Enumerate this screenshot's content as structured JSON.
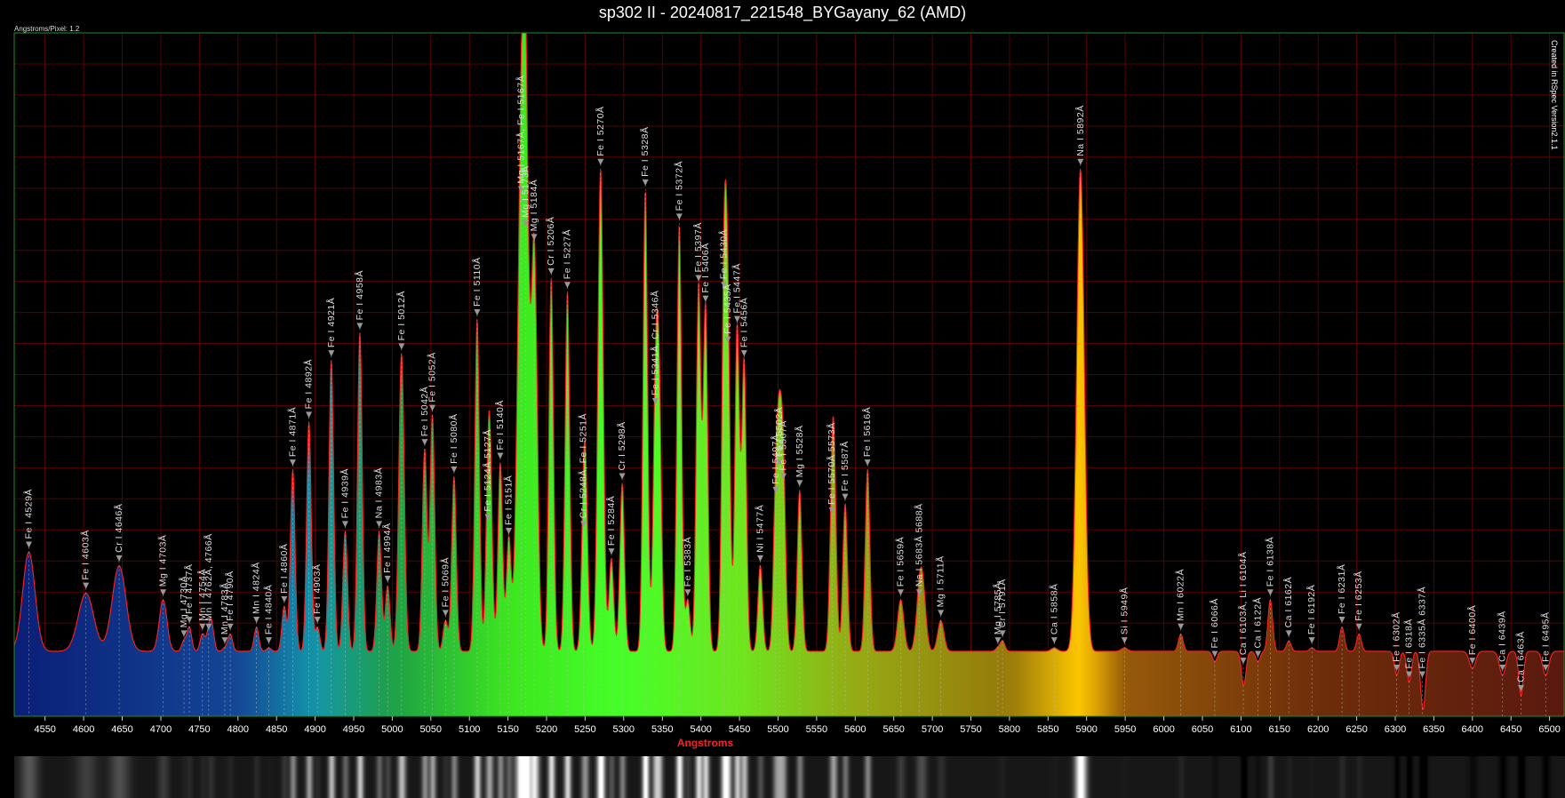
{
  "title": "sp302 II - 20240817_221548_BYGayany_62 (AMD)",
  "scale_label": "Angstroms/Pixel: 1.2",
  "credit": "Created in RSpec Version2.1.1",
  "colors": {
    "background": "#000000",
    "grid": "#5a0000",
    "profile": "#ff2020",
    "axis_title": "#ff2020",
    "frame": "#1f8f1f",
    "marker": "#999999"
  },
  "chart_data": {
    "type": "area",
    "title": "sp302 II - 20240817_221548_BYGayany_62 (AMD)",
    "xlabel": "Angstroms",
    "ylabel": "",
    "xlim": [
      4510,
      6520
    ],
    "ylim": [
      0,
      1.0
    ],
    "grid": true,
    "x_ticks": [
      4550,
      4600,
      4650,
      4700,
      4750,
      4800,
      4850,
      4900,
      4950,
      5000,
      5050,
      5100,
      5150,
      5200,
      5250,
      5300,
      5350,
      5400,
      5450,
      5500,
      5550,
      5600,
      5650,
      5700,
      5750,
      5800,
      5850,
      5900,
      5950,
      6000,
      6050,
      6100,
      6150,
      6200,
      6250,
      6300,
      6350,
      6400,
      6450,
      6500
    ],
    "baseline": 0.095,
    "peaks": [
      {
        "x": 4529,
        "y": 0.24,
        "w": 8
      },
      {
        "x": 4603,
        "y": 0.18,
        "w": 10
      },
      {
        "x": 4646,
        "y": 0.22,
        "w": 9
      },
      {
        "x": 4703,
        "y": 0.17,
        "w": 5
      },
      {
        "x": 4730,
        "y": 0.11,
        "w": 3
      },
      {
        "x": 4737,
        "y": 0.13,
        "w": 3
      },
      {
        "x": 4754,
        "y": 0.12,
        "w": 3
      },
      {
        "x": 4762,
        "y": 0.12,
        "w": 3
      },
      {
        "x": 4766,
        "y": 0.13,
        "w": 3
      },
      {
        "x": 4783,
        "y": 0.1,
        "w": 3
      },
      {
        "x": 4790,
        "y": 0.12,
        "w": 3
      },
      {
        "x": 4824,
        "y": 0.13,
        "w": 3
      },
      {
        "x": 4840,
        "y": 0.1,
        "w": 3
      },
      {
        "x": 4860,
        "y": 0.16,
        "w": 3
      },
      {
        "x": 4871,
        "y": 0.36,
        "w": 3
      },
      {
        "x": 4892,
        "y": 0.43,
        "w": 3
      },
      {
        "x": 4903,
        "y": 0.13,
        "w": 3
      },
      {
        "x": 4921,
        "y": 0.52,
        "w": 3
      },
      {
        "x": 4939,
        "y": 0.27,
        "w": 3
      },
      {
        "x": 4958,
        "y": 0.56,
        "w": 3
      },
      {
        "x": 4983,
        "y": 0.27,
        "w": 3
      },
      {
        "x": 4994,
        "y": 0.19,
        "w": 3
      },
      {
        "x": 5012,
        "y": 0.53,
        "w": 3.5
      },
      {
        "x": 5042,
        "y": 0.39,
        "w": 3
      },
      {
        "x": 5052,
        "y": 0.44,
        "w": 3
      },
      {
        "x": 5069,
        "y": 0.14,
        "w": 3
      },
      {
        "x": 5080,
        "y": 0.35,
        "w": 3
      },
      {
        "x": 5110,
        "y": 0.58,
        "w": 3
      },
      {
        "x": 5124,
        "y": 0.28,
        "w": 3
      },
      {
        "x": 5127,
        "y": 0.31,
        "w": 3
      },
      {
        "x": 5140,
        "y": 0.37,
        "w": 3
      },
      {
        "x": 5151,
        "y": 0.26,
        "w": 3
      },
      {
        "x": 5167,
        "y": 0.76,
        "w": 5
      },
      {
        "x": 5173,
        "y": 0.71,
        "w": 4
      },
      {
        "x": 5184,
        "y": 0.69,
        "w": 4
      },
      {
        "x": 5206,
        "y": 0.64,
        "w": 3
      },
      {
        "x": 5227,
        "y": 0.62,
        "w": 3
      },
      {
        "x": 5248,
        "y": 0.27,
        "w": 3
      },
      {
        "x": 5251,
        "y": 0.27,
        "w": 3
      },
      {
        "x": 5270,
        "y": 0.8,
        "w": 3.5
      },
      {
        "x": 5284,
        "y": 0.23,
        "w": 3
      },
      {
        "x": 5298,
        "y": 0.34,
        "w": 3
      },
      {
        "x": 5328,
        "y": 0.77,
        "w": 3
      },
      {
        "x": 5341,
        "y": 0.45,
        "w": 3
      },
      {
        "x": 5346,
        "y": 0.45,
        "w": 3
      },
      {
        "x": 5372,
        "y": 0.72,
        "w": 3
      },
      {
        "x": 5383,
        "y": 0.17,
        "w": 3
      },
      {
        "x": 5397,
        "y": 0.63,
        "w": 3
      },
      {
        "x": 5406,
        "y": 0.6,
        "w": 3
      },
      {
        "x": 5430,
        "y": 0.62,
        "w": 3
      },
      {
        "x": 5435,
        "y": 0.54,
        "w": 3
      },
      {
        "x": 5447,
        "y": 0.57,
        "w": 3
      },
      {
        "x": 5456,
        "y": 0.52,
        "w": 3
      },
      {
        "x": 5477,
        "y": 0.22,
        "w": 3
      },
      {
        "x": 5497,
        "y": 0.32,
        "w": 3
      },
      {
        "x": 5502,
        "y": 0.36,
        "w": 3
      },
      {
        "x": 5507,
        "y": 0.34,
        "w": 3
      },
      {
        "x": 5528,
        "y": 0.33,
        "w": 3
      },
      {
        "x": 5570,
        "y": 0.29,
        "w": 3
      },
      {
        "x": 5573,
        "y": 0.29,
        "w": 3
      },
      {
        "x": 5587,
        "y": 0.31,
        "w": 3
      },
      {
        "x": 5616,
        "y": 0.36,
        "w": 3
      },
      {
        "x": 5659,
        "y": 0.17,
        "w": 4
      },
      {
        "x": 5683,
        "y": 0.17,
        "w": 4
      },
      {
        "x": 5688,
        "y": 0.17,
        "w": 4
      },
      {
        "x": 5711,
        "y": 0.14,
        "w": 4
      },
      {
        "x": 5785,
        "y": 0.1,
        "w": 3
      },
      {
        "x": 5791,
        "y": 0.11,
        "w": 3
      },
      {
        "x": 5858,
        "y": 0.1,
        "w": 4
      },
      {
        "x": 5892,
        "y": 0.8,
        "w": 5
      },
      {
        "x": 5949,
        "y": 0.1,
        "w": 4
      },
      {
        "x": 6022,
        "y": 0.12,
        "w": 3
      },
      {
        "x": 6066,
        "y": 0.08,
        "w": 3
      },
      {
        "x": 6103,
        "y": 0.07,
        "w": 3
      },
      {
        "x": 6104,
        "y": 0.07,
        "w": 3
      },
      {
        "x": 6122,
        "y": 0.08,
        "w": 3
      },
      {
        "x": 6138,
        "y": 0.17,
        "w": 3
      },
      {
        "x": 6162,
        "y": 0.11,
        "w": 3
      },
      {
        "x": 6192,
        "y": 0.1,
        "w": 3
      },
      {
        "x": 6231,
        "y": 0.13,
        "w": 3
      },
      {
        "x": 6253,
        "y": 0.12,
        "w": 3
      },
      {
        "x": 6302,
        "y": 0.06,
        "w": 3
      },
      {
        "x": 6318,
        "y": 0.05,
        "w": 3
      },
      {
        "x": 6335,
        "y": 0.05,
        "w": 3
      },
      {
        "x": 6337,
        "y": 0.05,
        "w": 3
      },
      {
        "x": 6400,
        "y": 0.07,
        "w": 4
      },
      {
        "x": 6439,
        "y": 0.06,
        "w": 4
      },
      {
        "x": 6463,
        "y": 0.03,
        "w": 3
      },
      {
        "x": 6495,
        "y": 0.06,
        "w": 4
      }
    ],
    "annotations": [
      {
        "x": 4529,
        "y": 0.24,
        "text": "Fe I 4529Å"
      },
      {
        "x": 4603,
        "y": 0.18,
        "text": "Fe I 4603Å"
      },
      {
        "x": 4646,
        "y": 0.22,
        "text": "Cr I 4646Å"
      },
      {
        "x": 4703,
        "y": 0.17,
        "text": "Mg I 4703Å"
      },
      {
        "x": 4730,
        "y": 0.11,
        "text": "Mg I 4730Å"
      },
      {
        "x": 4737,
        "y": 0.13,
        "text": "Fe I 4737Å"
      },
      {
        "x": 4754,
        "y": 0.12,
        "text": "Mn I 4754Å"
      },
      {
        "x": 4762,
        "y": 0.12,
        "text": "Mn I 4762Å, 4766Å"
      },
      {
        "x": 4783,
        "y": 0.1,
        "text": "Mn I 4783Å"
      },
      {
        "x": 4790,
        "y": 0.12,
        "text": "Fe I 4790Å"
      },
      {
        "x": 4824,
        "y": 0.13,
        "text": "Mn I 4824Å"
      },
      {
        "x": 4840,
        "y": 0.1,
        "text": "Fe I 4840Å"
      },
      {
        "x": 4860,
        "y": 0.16,
        "text": "Fe I 4860Å"
      },
      {
        "x": 4871,
        "y": 0.36,
        "text": "Fe I 4871Å"
      },
      {
        "x": 4892,
        "y": 0.43,
        "text": "Fe I 4892Å"
      },
      {
        "x": 4903,
        "y": 0.13,
        "text": "Fe I 4903Å"
      },
      {
        "x": 4921,
        "y": 0.52,
        "text": "Fe I 4921Å"
      },
      {
        "x": 4939,
        "y": 0.27,
        "text": "Fe I 4939Å"
      },
      {
        "x": 4958,
        "y": 0.56,
        "text": "Fe I 4958Å"
      },
      {
        "x": 4983,
        "y": 0.27,
        "text": "Na I 4983Å"
      },
      {
        "x": 4994,
        "y": 0.19,
        "text": "Fe I 4994Å"
      },
      {
        "x": 5012,
        "y": 0.53,
        "text": "Fe I 5012Å"
      },
      {
        "x": 5042,
        "y": 0.39,
        "text": "Fe I 5042Å"
      },
      {
        "x": 5052,
        "y": 0.44,
        "text": "Fe I 5052Å"
      },
      {
        "x": 5069,
        "y": 0.14,
        "text": "Fe I 5069Å"
      },
      {
        "x": 5080,
        "y": 0.35,
        "text": "Fe I 5080Å"
      },
      {
        "x": 5110,
        "y": 0.58,
        "text": "Fe I 5110Å"
      },
      {
        "x": 5124,
        "y": 0.28,
        "text": "Fe I 5124Å 5127Å"
      },
      {
        "x": 5140,
        "y": 0.37,
        "text": "Fe I 5140Å"
      },
      {
        "x": 5151,
        "y": 0.26,
        "text": "Fe I 5151Å"
      },
      {
        "x": 5167,
        "y": 0.76,
        "text": "Mg I 5167Å, Fe I 5167Å"
      },
      {
        "x": 5173,
        "y": 0.71,
        "text": "Mg I 5173Å"
      },
      {
        "x": 5184,
        "y": 0.69,
        "text": "Mg I 5184Å"
      },
      {
        "x": 5206,
        "y": 0.64,
        "text": "Cr I 5206Å"
      },
      {
        "x": 5227,
        "y": 0.62,
        "text": "Fe I 5227Å"
      },
      {
        "x": 5248,
        "y": 0.27,
        "text": "Cr I 5248Å, Fe I 5251Å"
      },
      {
        "x": 5270,
        "y": 0.8,
        "text": "Fe I 5270Å"
      },
      {
        "x": 5284,
        "y": 0.23,
        "text": "Fe I 5284Å"
      },
      {
        "x": 5298,
        "y": 0.34,
        "text": "Cr I 5298Å"
      },
      {
        "x": 5328,
        "y": 0.77,
        "text": "Fe I 5328Å"
      },
      {
        "x": 5341,
        "y": 0.45,
        "text": "Fe I 5341Å, Cr I 5346Å"
      },
      {
        "x": 5372,
        "y": 0.72,
        "text": "Fe I 5372Å"
      },
      {
        "x": 5383,
        "y": 0.17,
        "text": "Fe I 5383Å"
      },
      {
        "x": 5397,
        "y": 0.63,
        "text": "Fe I 5397Å"
      },
      {
        "x": 5406,
        "y": 0.6,
        "text": "Fe I 5406Å"
      },
      {
        "x": 5430,
        "y": 0.62,
        "text": "Fe I 5430Å"
      },
      {
        "x": 5435,
        "y": 0.54,
        "text": "Fe I 5435Å"
      },
      {
        "x": 5447,
        "y": 0.57,
        "text": "Fe I 5447Å"
      },
      {
        "x": 5456,
        "y": 0.52,
        "text": "Fe I 5456Å"
      },
      {
        "x": 5477,
        "y": 0.22,
        "text": "Ni I 5477Å"
      },
      {
        "x": 5497,
        "y": 0.32,
        "text": "Fe I 5497Å"
      },
      {
        "x": 5502,
        "y": 0.36,
        "text": "Fe I 5502Å"
      },
      {
        "x": 5507,
        "y": 0.34,
        "text": "Fe I 5507Å"
      },
      {
        "x": 5528,
        "y": 0.33,
        "text": "Mg I 5528Å"
      },
      {
        "x": 5570,
        "y": 0.29,
        "text": "Fe I 5570Å 5573Å"
      },
      {
        "x": 5587,
        "y": 0.31,
        "text": "Fe I 5587Å"
      },
      {
        "x": 5616,
        "y": 0.36,
        "text": "Fe I 5616Å"
      },
      {
        "x": 5659,
        "y": 0.17,
        "text": "Fe I 5659Å"
      },
      {
        "x": 5683,
        "y": 0.17,
        "text": "Na I 5683Å 5688Å"
      },
      {
        "x": 5711,
        "y": 0.14,
        "text": "Mg I 5711Å"
      },
      {
        "x": 5785,
        "y": 0.1,
        "text": "Mg I 5785Å"
      },
      {
        "x": 5791,
        "y": 0.11,
        "text": "Cr I 5791Å"
      },
      {
        "x": 5858,
        "y": 0.1,
        "text": "Ca I 5858Å"
      },
      {
        "x": 5892,
        "y": 0.8,
        "text": "Na I 5892Å"
      },
      {
        "x": 5949,
        "y": 0.1,
        "text": "Si I 5949Å"
      },
      {
        "x": 6022,
        "y": 0.12,
        "text": "Mn I 6022Å"
      },
      {
        "x": 6066,
        "y": 0.08,
        "text": "Fe I 6066Å"
      },
      {
        "x": 6103,
        "y": 0.07,
        "text": "Ca I 6103Å, Li I 6104Å"
      },
      {
        "x": 6122,
        "y": 0.08,
        "text": "Ca I 6122Å"
      },
      {
        "x": 6138,
        "y": 0.17,
        "text": "Fe I 6138Å"
      },
      {
        "x": 6162,
        "y": 0.11,
        "text": "Ca I 6162Å"
      },
      {
        "x": 6192,
        "y": 0.1,
        "text": "Fe I 6192Å"
      },
      {
        "x": 6231,
        "y": 0.13,
        "text": "Fe I 6231Å"
      },
      {
        "x": 6253,
        "y": 0.12,
        "text": "Fe I 6253Å"
      },
      {
        "x": 6302,
        "y": 0.06,
        "text": "Fe I 6302Å"
      },
      {
        "x": 6318,
        "y": 0.05,
        "text": "Fe I 6318Å"
      },
      {
        "x": 6335,
        "y": 0.05,
        "text": "Fe I 6335Å 6337Å"
      },
      {
        "x": 6400,
        "y": 0.07,
        "text": "Fe I 6400Å"
      },
      {
        "x": 6439,
        "y": 0.06,
        "text": "Ca I 6439Å"
      },
      {
        "x": 6463,
        "y": 0.03,
        "text": "Ca I 6463Å"
      },
      {
        "x": 6495,
        "y": 0.06,
        "text": "Fe I 6495Å"
      }
    ]
  }
}
